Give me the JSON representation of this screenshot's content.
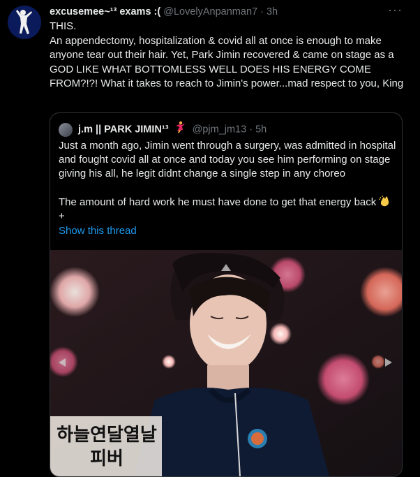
{
  "tweet": {
    "author_name": "excusemee~¹³ exams :(",
    "author_handle": "@LovelyAnpanman7",
    "separator": "·",
    "time": "3h",
    "more_label": "···",
    "text_lines": [
      "THIS.",
      "An appendectomy, hospitalization & covid all at once is enough to make anyone tear out their hair. Yet, Park Jimin recovered & came on stage as a GOD LIKE WHAT BOTTOMLESS WELL DOES HIS ENERGY COME FROM?!?! What it takes to reach to Jimin's power...mad respect to you, King"
    ]
  },
  "quoted": {
    "author_name": "j.m || PARK JIMIN¹³",
    "author_handle": "@pjm_jm13",
    "separator": "·",
    "time": "5h",
    "paragraph1": "Just a month ago, Jimin went through a surgery, was admitted in hospital and fought covid all at once and today you see him performing on stage giving his all, he legit didnt change a single step in any choreo",
    "paragraph2": "The amount of hard work he must have done to get that energy back",
    "plus": "+",
    "show_thread": "Show this thread",
    "image_caption_line1": "하늘연달열날",
    "image_caption_line2": "피버"
  },
  "colors": {
    "background": "#000000",
    "text": "#e7e9ea",
    "muted": "#71767b",
    "link": "#1d9bf0",
    "border": "#2f3336"
  }
}
